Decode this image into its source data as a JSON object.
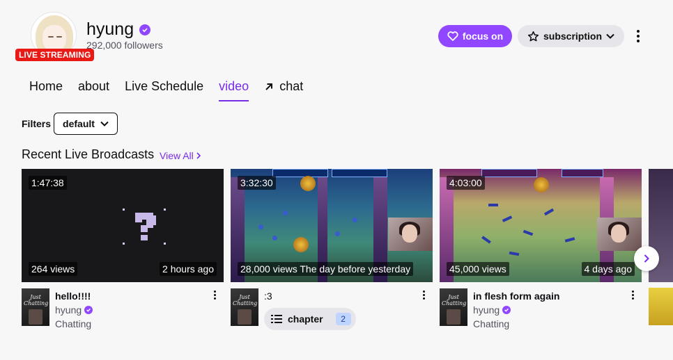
{
  "channel": {
    "name": "hyung",
    "followers": "292,000 followers",
    "live_badge": "LIVE STREAMING",
    "verified_icon": "verified-check-icon"
  },
  "actions": {
    "focus_label": "focus on",
    "subscription_label": "subscription"
  },
  "tabs": [
    {
      "label": "Home"
    },
    {
      "label": "about"
    },
    {
      "label": "Live Schedule"
    },
    {
      "label": "video",
      "active": true
    },
    {
      "label": "chat",
      "icon": "arrow-up-right-icon"
    }
  ],
  "filters": {
    "label": "Filters",
    "selected": "default"
  },
  "section": {
    "title": "Recent Live Broadcasts",
    "view_all": "View All"
  },
  "videos": [
    {
      "duration": "1:47:38",
      "views": "264 views",
      "age": "2 hours ago",
      "title": "hello!!!!",
      "channel": "hyung",
      "category": "Chatting",
      "thumbnail": "placeholder-question"
    },
    {
      "duration": "3:32:30",
      "views_age": "28,000 views The day before yesterday",
      "title": ":3",
      "chapter_label": "chapter",
      "chapter_count": "2",
      "thumbnail": "game-pinball"
    },
    {
      "duration": "4:03:00",
      "views": "45,000 views",
      "age": "4 days ago",
      "title": "in flesh form again",
      "channel": "hyung",
      "category": "Chatting",
      "thumbnail": "game-pinball-2"
    }
  ],
  "avatar_text": "Just Chatting",
  "colors": {
    "accent": "#9147ff",
    "live": "#e91916",
    "active_tab": "#772ce8"
  }
}
